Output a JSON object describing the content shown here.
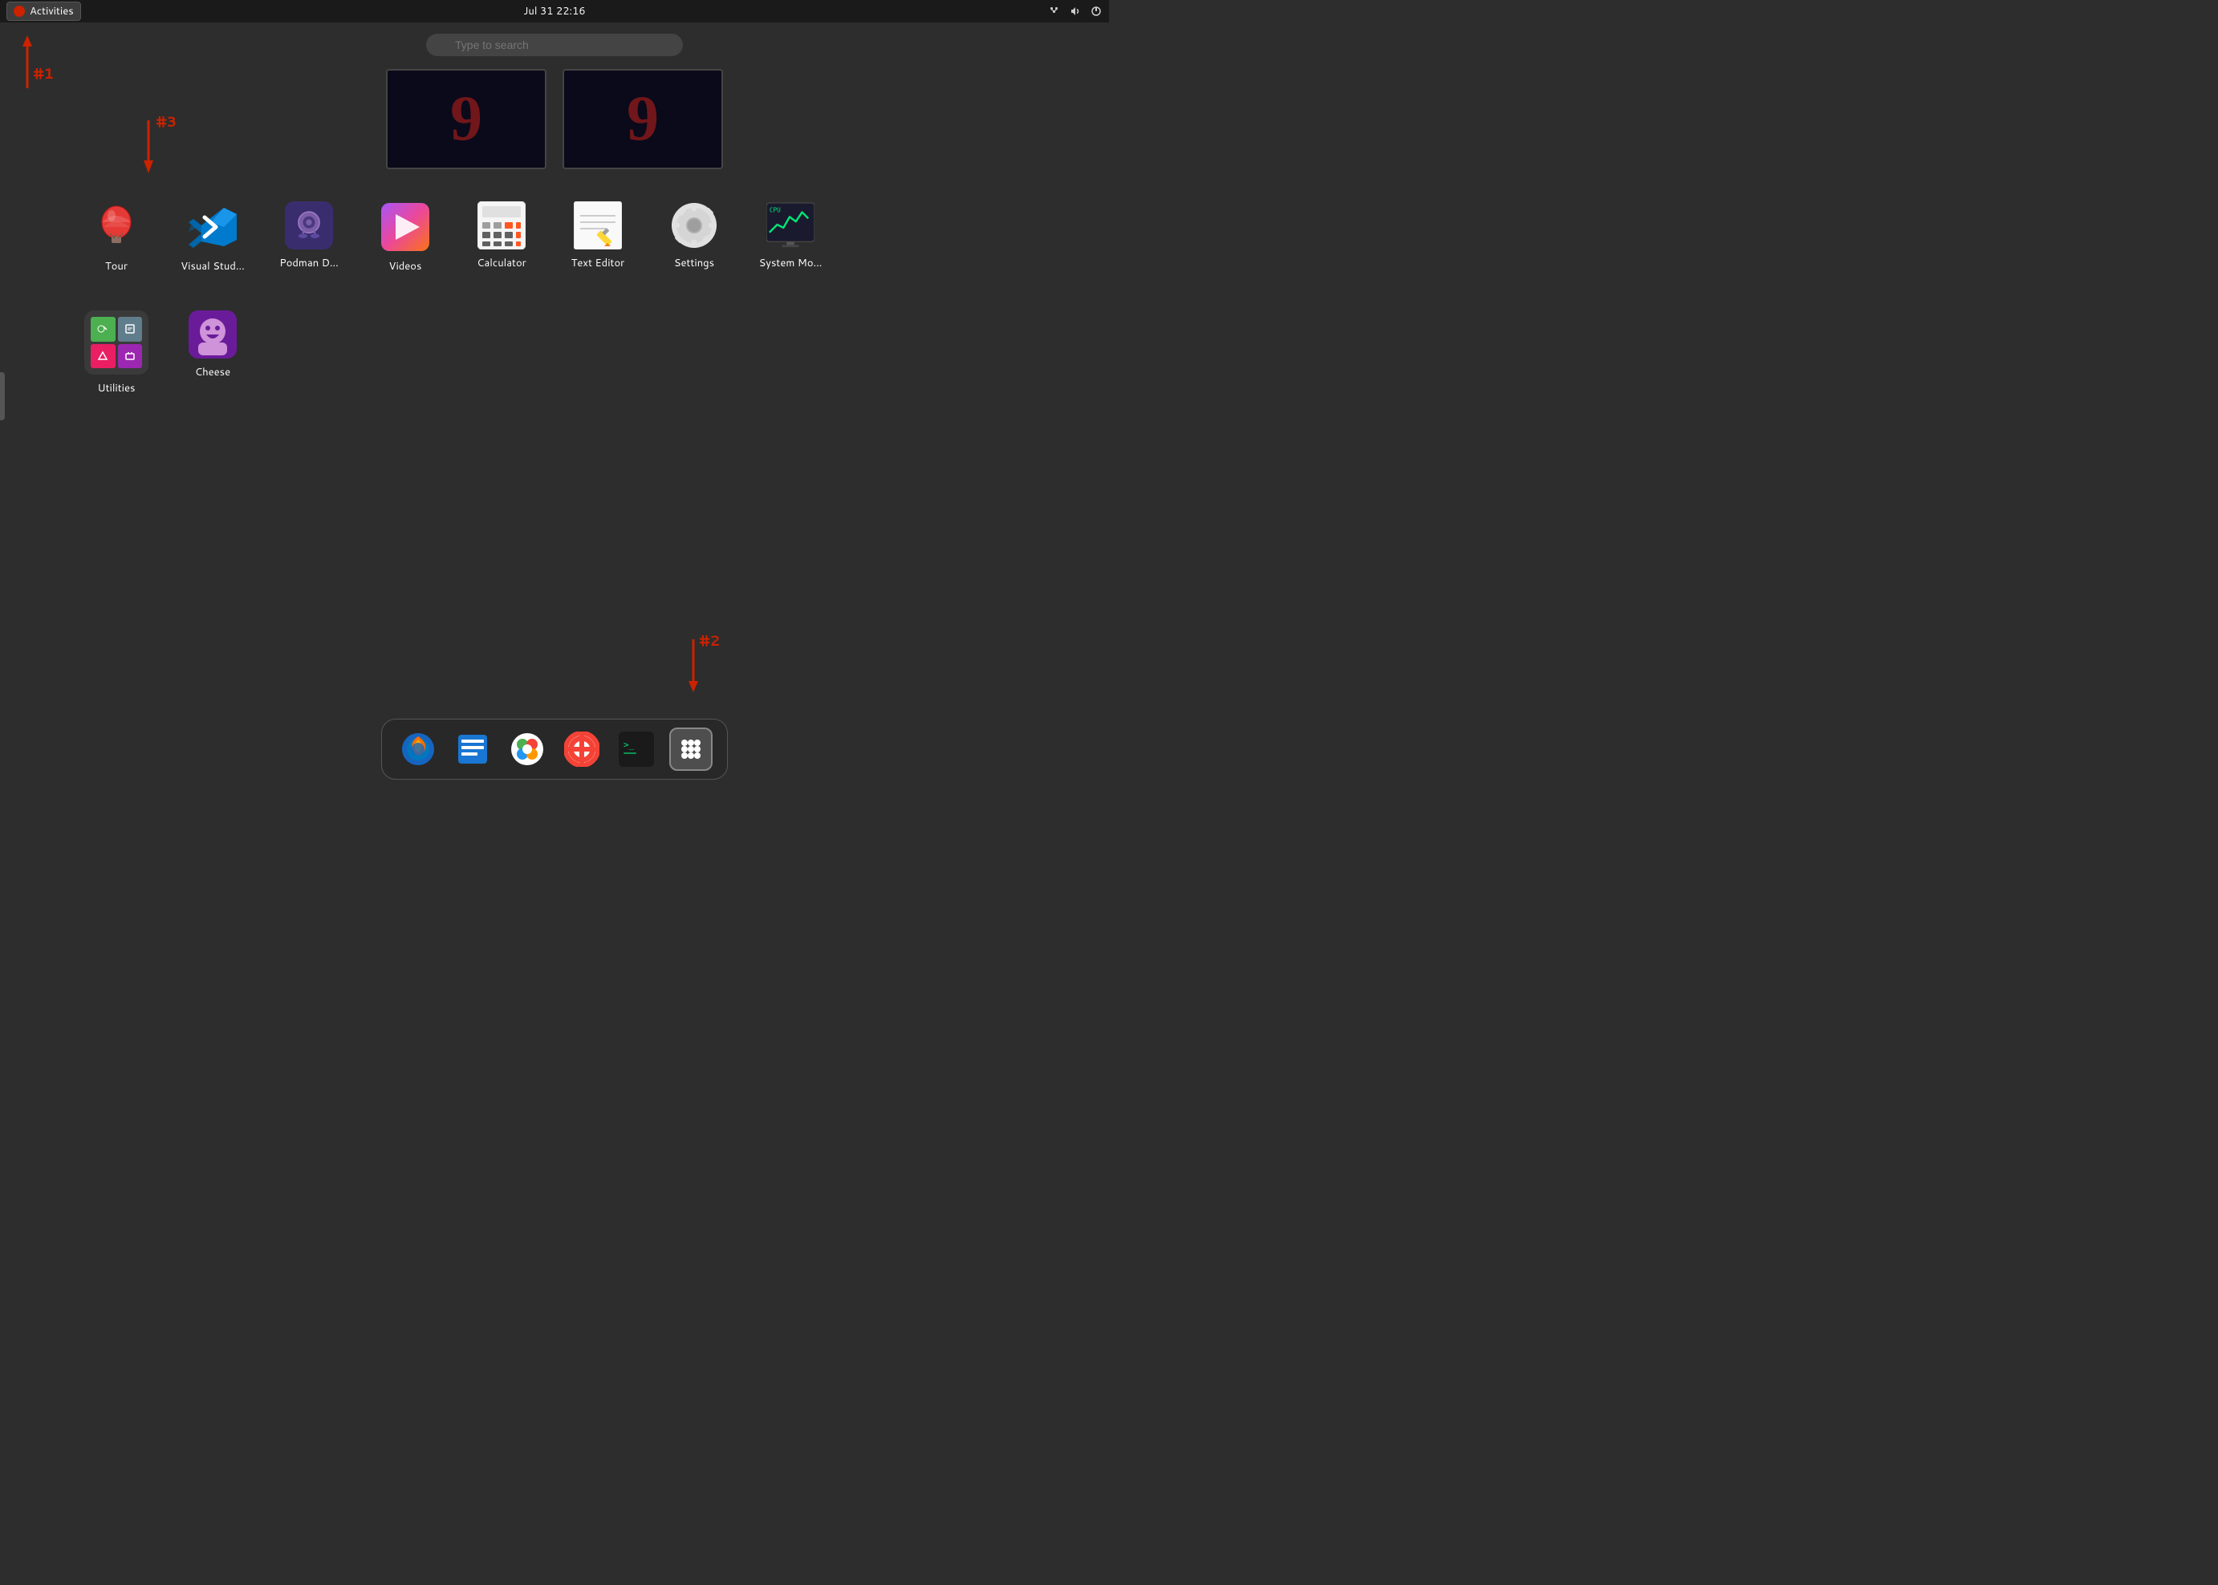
{
  "topbar": {
    "activities_label": "Activities",
    "datetime": "Jul 31  22:16"
  },
  "search": {
    "placeholder": "Type to search"
  },
  "thumbnails": [
    {
      "id": "thumb1",
      "number": "9"
    },
    {
      "id": "thumb2",
      "number": "9"
    }
  ],
  "apps": [
    {
      "id": "tour",
      "label": "Tour"
    },
    {
      "id": "vscode",
      "label": "Visual Stud..."
    },
    {
      "id": "podman",
      "label": "Podman D..."
    },
    {
      "id": "videos",
      "label": "Videos"
    },
    {
      "id": "calculator",
      "label": "Calculator"
    },
    {
      "id": "texteditor",
      "label": "Text Editor"
    },
    {
      "id": "settings",
      "label": "Settings"
    },
    {
      "id": "sysmon",
      "label": "System Mo..."
    }
  ],
  "row2_apps": [
    {
      "id": "utilities",
      "label": "Utilities"
    },
    {
      "id": "cheese",
      "label": "Cheese"
    }
  ],
  "dock": {
    "items": [
      {
        "id": "firefox",
        "label": "Firefox"
      },
      {
        "id": "notes",
        "label": "Notes"
      },
      {
        "id": "flathub",
        "label": "Flathub"
      },
      {
        "id": "help",
        "label": "Help"
      },
      {
        "id": "terminal",
        "label": "Terminal"
      },
      {
        "id": "appgrid",
        "label": "App Grid"
      }
    ]
  },
  "annotations": {
    "1": "#1",
    "2": "#2",
    "3": "#3"
  }
}
